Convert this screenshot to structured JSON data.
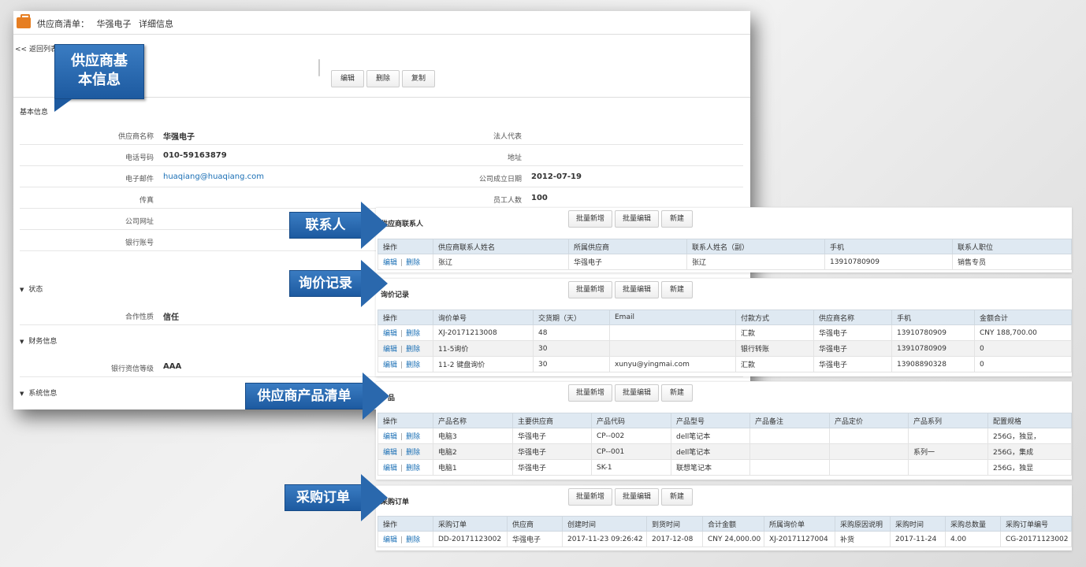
{
  "header": {
    "crumb_label": "供应商清单：",
    "supplier_name": "华强电子",
    "page_label": "详细信息"
  },
  "back_link": "<< 返回列表",
  "toolbar": {
    "edit_label": "编辑",
    "delete_label": "删除",
    "copy_label": "复制"
  },
  "basic_info": {
    "section_title": "基本信息",
    "fields": {
      "supplier_name": {
        "label": "供应商名称",
        "value": "华强电子"
      },
      "legal_rep": {
        "label": "法人代表",
        "value": ""
      },
      "phone": {
        "label": "电话号码",
        "value": "010-59163879"
      },
      "address": {
        "label": "地址",
        "value": ""
      },
      "email": {
        "label": "电子邮件",
        "value": "huaqiang@huaqiang.com"
      },
      "founded": {
        "label": "公司成立日期",
        "value": "2012-07-19"
      },
      "fax": {
        "label": "传真",
        "value": ""
      },
      "employees": {
        "label": "员工人数",
        "value": "100"
      },
      "website": {
        "label": "公司网址",
        "value": ""
      },
      "bank_account": {
        "label": "银行账号",
        "value": ""
      }
    }
  },
  "status_section": {
    "title": "状态",
    "coop_label": "合作性质",
    "coop_value": "信任"
  },
  "finance_section": {
    "title": "财务信息",
    "credit_label": "银行资信等级",
    "credit_value": "AAA"
  },
  "system_section": {
    "title": "系统信息"
  },
  "callouts": {
    "basic": "供应商基本信息",
    "contacts": "联系人",
    "inquiries": "询价记录",
    "products": "供应商产品清单",
    "orders": "采购订单"
  },
  "common_buttons": {
    "batch_add": "批量新增",
    "batch_edit": "批量编辑",
    "create": "新建"
  },
  "row_ops": {
    "edit": "编辑",
    "sep": "|",
    "delete": "删除"
  },
  "contacts": {
    "title": "供应商联系人",
    "columns": [
      "操作",
      "供应商联系人姓名",
      "所属供应商",
      "联系人姓名（副）",
      "手机",
      "联系人职位"
    ],
    "rows": [
      [
        "张辽",
        "华强电子",
        "张辽",
        "13910780909",
        "销售专员"
      ]
    ]
  },
  "inquiries": {
    "title": "询价记录",
    "columns": [
      "操作",
      "询价单号",
      "交货期（天）",
      "Email",
      "付款方式",
      "供应商名称",
      "手机",
      "金额合计"
    ],
    "rows": [
      [
        "XJ-20171213008",
        "48",
        "",
        "汇款",
        "华强电子",
        "13910780909",
        "CNY 188,700.00"
      ],
      [
        "11-5询价",
        "30",
        "",
        "银行转账",
        "华强电子",
        "13910780909",
        "0"
      ],
      [
        "11-2 键盘询价",
        "30",
        "xunyu@yingmai.com",
        "汇款",
        "华强电子",
        "13908890328",
        "0"
      ]
    ]
  },
  "products": {
    "title": "产品",
    "columns": [
      "操作",
      "产品名称",
      "主要供应商",
      "产品代码",
      "产品型号",
      "产品备注",
      "产品定价",
      "产品系列",
      "配置规格"
    ],
    "rows": [
      [
        "电脑3",
        "华强电子",
        "CP--002",
        "dell笔记本",
        "",
        "",
        "",
        "256G，独显，"
      ],
      [
        "电脑2",
        "华强电子",
        "CP--001",
        "dell笔记本",
        "",
        "",
        "系列一",
        "256G，集成"
      ],
      [
        "电脑1",
        "华强电子",
        "SK-1",
        "联想笔记本",
        "",
        "",
        "",
        "256G，独显"
      ]
    ]
  },
  "orders": {
    "title": "采购订单",
    "columns": [
      "操作",
      "采购订单",
      "供应商",
      "创建时间",
      "到货时间",
      "合计金额",
      "所属询价单",
      "采购原因说明",
      "采购时间",
      "采购总数量",
      "采购订单编号"
    ],
    "rows": [
      [
        "DD-20171123002",
        "华强电子",
        "2017-11-23 09:26:42",
        "2017-12-08",
        "CNY 24,000.00",
        "XJ-20171127004",
        "补货",
        "2017-11-24",
        "4.00",
        "CG-20171123002"
      ]
    ]
  },
  "colors": {
    "accent_blue": "#2a68ad",
    "link": "#1a6fb5",
    "table_header": "#dfe9f2",
    "folder": "#e67e22"
  }
}
